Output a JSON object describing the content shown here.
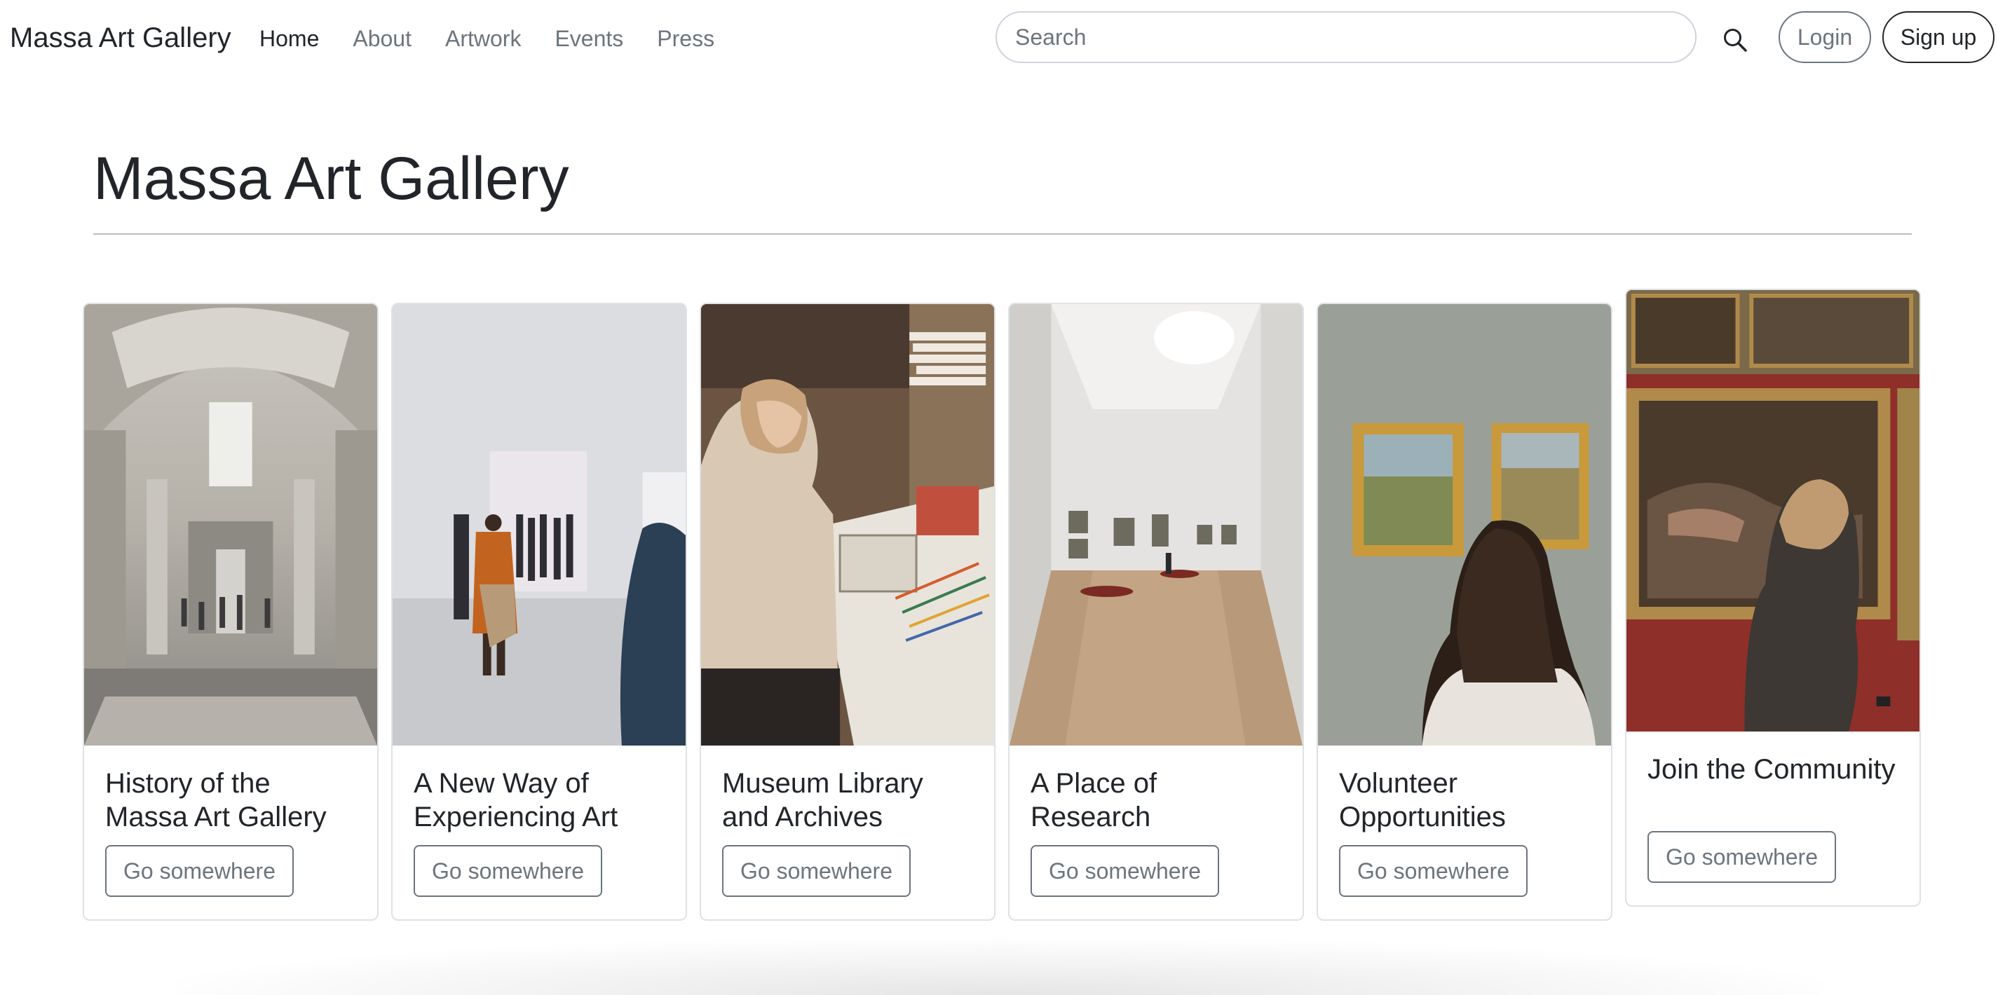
{
  "navbar": {
    "brand": "Massa Art Gallery",
    "links": [
      {
        "label": "Home",
        "active": true
      },
      {
        "label": "About",
        "active": false
      },
      {
        "label": "Artwork",
        "active": false
      },
      {
        "label": "Events",
        "active": false
      },
      {
        "label": "Press",
        "active": false
      }
    ],
    "search": {
      "placeholder": "Search",
      "value": ""
    },
    "search_icon": "search-icon",
    "login_label": "Login",
    "signup_label": "Sign up"
  },
  "main": {
    "title": "Massa Art Gallery"
  },
  "cards": [
    {
      "title": "History of the Massa Art Gallery",
      "button": "Go somewhere",
      "image": "vaulted-gallery-hall-photo"
    },
    {
      "title": "A New Way of Experiencing Art",
      "button": "Go somewhere",
      "image": "white-gallery-visitors-photo"
    },
    {
      "title": "Museum Library and Archives",
      "button": "Go somewhere",
      "image": "woman-drawing-at-desk-photo"
    },
    {
      "title": "A Place of Research",
      "button": "Go somewhere",
      "image": "gallery-room-skylight-photo"
    },
    {
      "title": "Volunteer Opportunities",
      "button": "Go somewhere",
      "image": "woman-viewing-paintings-photo"
    },
    {
      "title": "Join the Community",
      "button": "Go somewhere",
      "image": "woman-viewing-large-painting-photo"
    }
  ],
  "colors": {
    "text": "#212529",
    "muted": "#6c757d",
    "border": "#dee2e6"
  }
}
